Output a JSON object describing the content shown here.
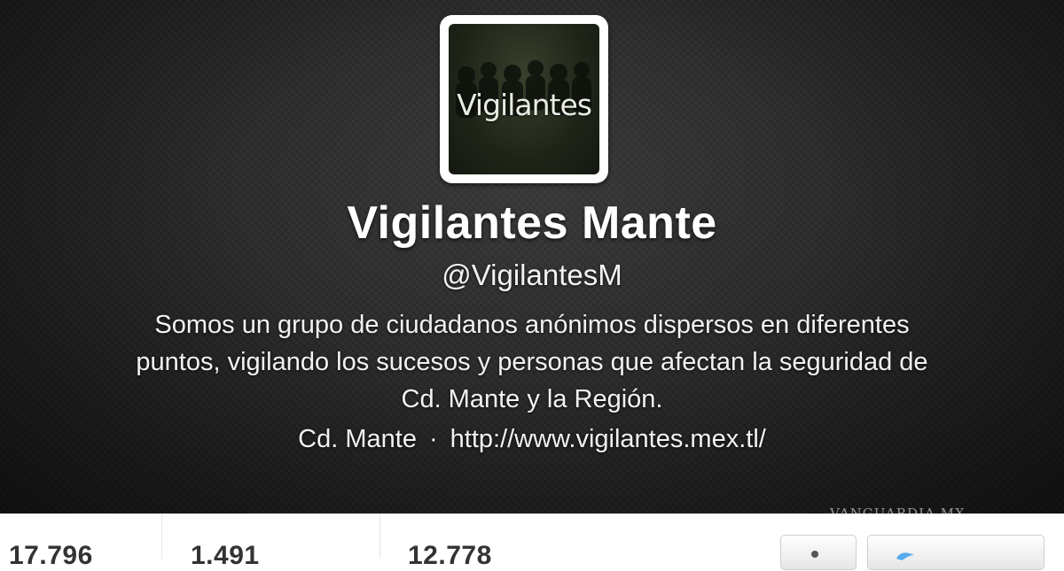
{
  "profile": {
    "avatar_text": "Vigilantes",
    "name": "Vigilantes Mante",
    "handle": "@VigilantesM",
    "bio_lines": [
      "Somos un grupo de ciudadanos anónimos dispersos en diferentes",
      "puntos, vigilando los sucesos y personas que afectan la seguridad de",
      "Cd. Mante y la Región."
    ],
    "location": "Cd. Mante",
    "separator": "·",
    "url": "http://www.vigilantes.mex.tl/"
  },
  "stats": {
    "tweets": "17.796",
    "following": "1.491",
    "followers": "12.778"
  },
  "watermark": "VANGUARDIA MX",
  "colors": {
    "header_bg": "#2a2a2a",
    "text": "#ffffff",
    "stats_text": "#333333"
  }
}
